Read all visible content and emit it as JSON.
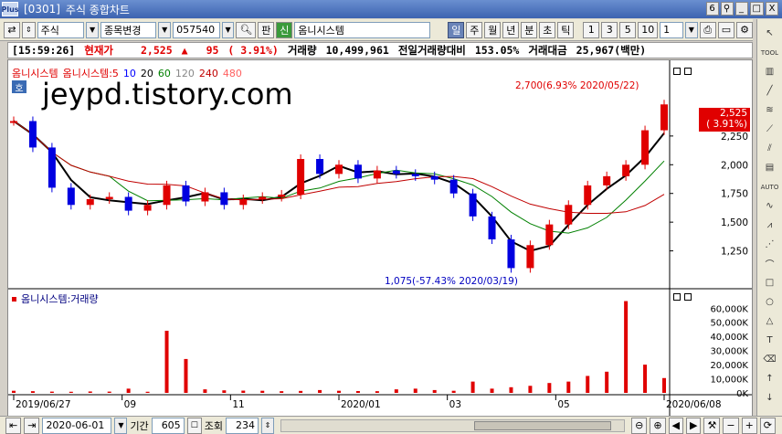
{
  "window": {
    "code": "[0301]",
    "title": "주식 종합차트",
    "page_num": "6",
    "pin": "⚲",
    "minimize": "_",
    "restore": "□",
    "close": "X"
  },
  "toolbar": {
    "market": "주식",
    "change_item": "종목변경",
    "code": "057540",
    "pan": "판",
    "shin": "신",
    "stock_name": "옴니시스템",
    "periods": [
      "일",
      "주",
      "월",
      "년",
      "분",
      "초",
      "틱"
    ],
    "numbers": [
      "1",
      "3",
      "5",
      "10"
    ],
    "interval": "1"
  },
  "status": {
    "time": "[15:59:26]",
    "price_label": "현재가",
    "price": "2,525",
    "arrow": "▲",
    "change": "95",
    "change_pct": "( 3.91%)",
    "volume_label": "거래량",
    "volume": "10,499,961",
    "prev_ratio_label": "전일거래량대비",
    "prev_ratio": "153.05%",
    "amount_label": "거래대금",
    "amount": "25,967(백만)"
  },
  "legend": {
    "name": "옴니시스템",
    "ma_name": "옴니시스템:5",
    "ma": [
      "10",
      "20",
      "60",
      "120",
      "240",
      "480"
    ],
    "badge": "호",
    "volume_name": "옴니시스템:거래량"
  },
  "watermark": "jeypd.tistory.com",
  "annotations": {
    "high": "2,700(6.93% 2020/05/22)",
    "low": "1,075(-57.43% 2020/03/19)"
  },
  "price_box": {
    "price": "2,525",
    "pct": "( 3.91%)"
  },
  "colors": {
    "up": "#e00000",
    "down": "#0000e0",
    "ma5": "#ff0000",
    "ma10": "#0000ff",
    "ma20": "#000000",
    "ma60": "#008000",
    "ma120": "#888888",
    "ma240": "#c00000",
    "ma480": "#ff6060"
  },
  "chart_data": [
    {
      "type": "candlestick",
      "y_ticks": [
        "2,250",
        "2,000",
        "1,750",
        "1,500",
        "1,250"
      ],
      "ylim": [
        1000,
        2750
      ],
      "x_ticks": [
        "2019/06/27",
        "09",
        "11",
        "2020/01",
        "03",
        "05",
        "2020/06/08"
      ],
      "series": [
        {
          "name": "옴니시스템",
          "values": [
            2380,
            2150,
            1800,
            1650,
            1700,
            1720,
            1600,
            1650,
            1820,
            1680,
            1760,
            1650,
            1700,
            1720,
            1740,
            2050,
            1920,
            2000,
            1880,
            1950,
            1920,
            1900,
            1870,
            1750,
            1550,
            1350,
            1100,
            1300,
            1480,
            1650,
            1820,
            1900,
            2000,
            2300,
            2525
          ]
        }
      ]
    },
    {
      "type": "bar",
      "y_ticks": [
        "60,000K",
        "50,000K",
        "40,000K",
        "30,000K",
        "20,000K",
        "10,000K",
        "0K"
      ],
      "ylim": [
        0,
        66000
      ],
      "series": [
        {
          "name": "옴니시스템:거래량",
          "values": [
            1500,
            1200,
            900,
            800,
            1000,
            900,
            3000,
            800,
            44000,
            24000,
            2500,
            1800,
            1600,
            1500,
            1200,
            1400,
            2000,
            1500,
            1300,
            1200,
            2500,
            3000,
            2000,
            1500,
            8000,
            3000,
            4000,
            5000,
            7000,
            8000,
            12000,
            15000,
            65000,
            20000,
            10500
          ]
        }
      ]
    }
  ],
  "bottom": {
    "date": "2020-06-01",
    "period_label": "기간",
    "period": "605",
    "view_label": "조회",
    "view": "234"
  },
  "right_icons": [
    "TOOL",
    "AUTO"
  ]
}
